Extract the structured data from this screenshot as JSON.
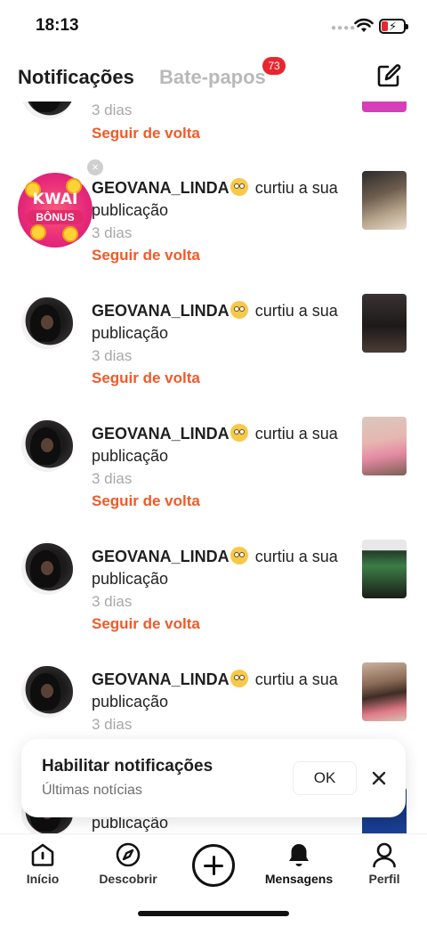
{
  "status_bar": {
    "time": "18:13"
  },
  "tabs": {
    "notifications": "Notificações",
    "chats": "Bate-papos",
    "chats_badge": "73"
  },
  "notifications": {
    "top_partial": {
      "time": "3 dias",
      "action": "Seguir de volta"
    },
    "kwai_avatar": {
      "line1": "KWAI",
      "line2": "BÔNUS"
    },
    "items": [
      {
        "username": "GEOVANA_LINDA",
        "emoji": "rolling-eyes-emoji",
        "text": " curtiu a sua publicação",
        "time": "3 dias",
        "action": "Seguir de volta"
      },
      {
        "username": "GEOVANA_LINDA",
        "emoji": "rolling-eyes-emoji",
        "text": " curtiu a sua publicação",
        "time": "3 dias",
        "action": "Seguir de volta"
      },
      {
        "username": "GEOVANA_LINDA",
        "emoji": "rolling-eyes-emoji",
        "text": " curtiu a sua publicação",
        "time": "3 dias",
        "action": "Seguir de volta"
      },
      {
        "username": "GEOVANA_LINDA",
        "emoji": "rolling-eyes-emoji",
        "text": " curtiu a sua publicação",
        "time": "3 dias",
        "action": "Seguir de volta"
      },
      {
        "username": "GEOVANA_LINDA",
        "emoji": "rolling-eyes-emoji",
        "text": " curtiu a sua publicação",
        "time": "3 dias"
      }
    ],
    "bottom_partial": {
      "text": "publicação"
    }
  },
  "toast": {
    "title": "Habilitar notificações",
    "subtitle": "Últimas notícias",
    "ok": "OK"
  },
  "bottom_nav": {
    "items": [
      {
        "label": "Início",
        "icon": "home-icon"
      },
      {
        "label": "Descobrir",
        "icon": "compass-icon"
      },
      {
        "label": "",
        "icon": "plus-icon"
      },
      {
        "label": "Mensagens",
        "icon": "bell-icon",
        "active": true
      },
      {
        "label": "Perfil",
        "icon": "person-icon"
      }
    ]
  },
  "colors": {
    "accent_follow": "#f05a28",
    "badge": "#e8262f",
    "muted_text": "#a8a8a8"
  }
}
